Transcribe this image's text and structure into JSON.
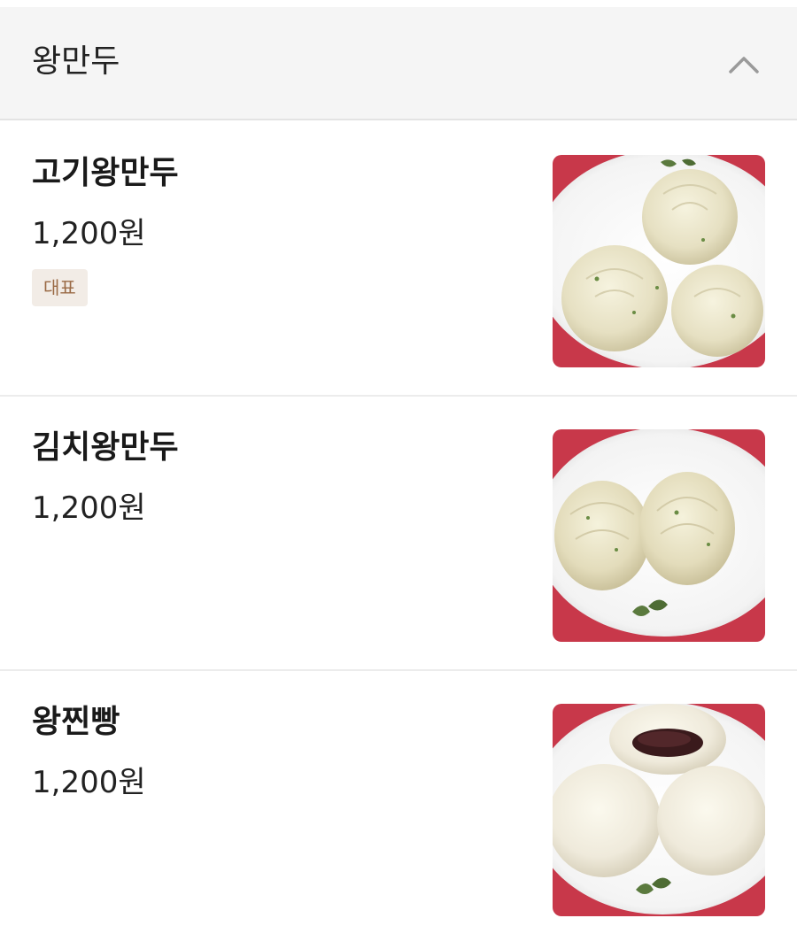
{
  "category": {
    "title": "왕만두",
    "toggle_icon": "chevron-up-icon"
  },
  "items": [
    {
      "name": "고기왕만두",
      "price": "1,200원",
      "badge": "대표",
      "photo": "meat-dumpling-photo"
    },
    {
      "name": "김치왕만두",
      "price": "1,200원",
      "photo": "kimchi-dumpling-photo"
    },
    {
      "name": "왕찐빵",
      "price": "1,200원",
      "photo": "steamed-bun-photo"
    }
  ],
  "colors": {
    "header_bg": "#f5f5f5",
    "badge_bg": "#f2ece6",
    "badge_text": "#9a6a45",
    "placemat_red": "#c8384a"
  }
}
